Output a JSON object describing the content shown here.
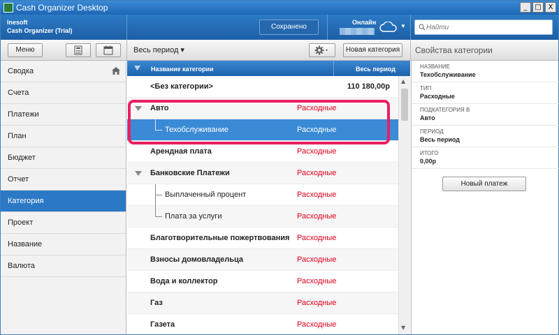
{
  "window": {
    "title": "Cash Organizer Desktop",
    "min": "_",
    "max": "□",
    "close": "X"
  },
  "header": {
    "company": "Inesoft",
    "product": "Cash Organizer (Trial)",
    "saved": "Сохранено",
    "online": "Онлайн",
    "search_placeholder": "Найти"
  },
  "toolbar": {
    "menu": "Меню",
    "period": "Весь период ▾",
    "new_category": "Новая категория",
    "props_title": "Свойства категории"
  },
  "sidebar": {
    "items": [
      {
        "label": "Сводка"
      },
      {
        "label": "Счета"
      },
      {
        "label": "Платежи"
      },
      {
        "label": "План"
      },
      {
        "label": "Бюджет"
      },
      {
        "label": "Отчет"
      },
      {
        "label": "Категория",
        "active": true
      },
      {
        "label": "Проект"
      },
      {
        "label": "Название"
      },
      {
        "label": "Валюта"
      }
    ]
  },
  "table": {
    "columns": {
      "name": "Название категории",
      "total": "Весь период"
    },
    "rows": [
      {
        "name": "<Без категории>",
        "type": "",
        "amount": "110 180,00р",
        "level": 0,
        "bold": true,
        "expander": false
      },
      {
        "name": "Авто",
        "type": "Расходные",
        "amount": "",
        "level": 0,
        "bold": true,
        "expander": true
      },
      {
        "name": "Техобслуживание",
        "type": "Расходные",
        "amount": "",
        "level": 1,
        "bold": false,
        "selected": true
      },
      {
        "name": "Арендная плата",
        "type": "Расходные",
        "amount": "",
        "level": 0,
        "bold": true,
        "expander": false
      },
      {
        "name": "Банковские Платежи",
        "type": "Расходные",
        "amount": "",
        "level": 0,
        "bold": true,
        "expander": true
      },
      {
        "name": "Выплаченный процент",
        "type": "Расходные",
        "amount": "",
        "level": 1,
        "bold": false
      },
      {
        "name": "Плата за услуги",
        "type": "Расходные",
        "amount": "",
        "level": 1,
        "bold": false
      },
      {
        "name": "Благотворительные пожертвования",
        "type": "Расходные",
        "amount": "",
        "level": 0,
        "bold": true
      },
      {
        "name": "Взносы домовладельца",
        "type": "Расходные",
        "amount": "",
        "level": 0,
        "bold": true
      },
      {
        "name": "Вода и коллектор",
        "type": "Расходные",
        "amount": "",
        "level": 0,
        "bold": true
      },
      {
        "name": "Газ",
        "type": "Расходные",
        "amount": "",
        "level": 0,
        "bold": true
      },
      {
        "name": "Газета",
        "type": "Расходные",
        "amount": "",
        "level": 0,
        "bold": true
      }
    ]
  },
  "properties": {
    "fields": [
      {
        "label": "Название",
        "value": "Техобслуживание"
      },
      {
        "label": "Тип",
        "value": "Расходные"
      },
      {
        "label": "Подкатегория в",
        "value": "Авто"
      },
      {
        "label": "Период",
        "value": "Весь период"
      },
      {
        "label": "Итого",
        "value": "0,00р"
      }
    ],
    "new_payment": "Новый платеж"
  },
  "colors": {
    "accent": "#2b78c6",
    "expense": "#e0001a",
    "highlight": "#ea1f62"
  },
  "icons": [
    "calculator-icon",
    "calendar-icon",
    "gear-icon",
    "home-icon",
    "cloud-icon",
    "search-icon"
  ]
}
